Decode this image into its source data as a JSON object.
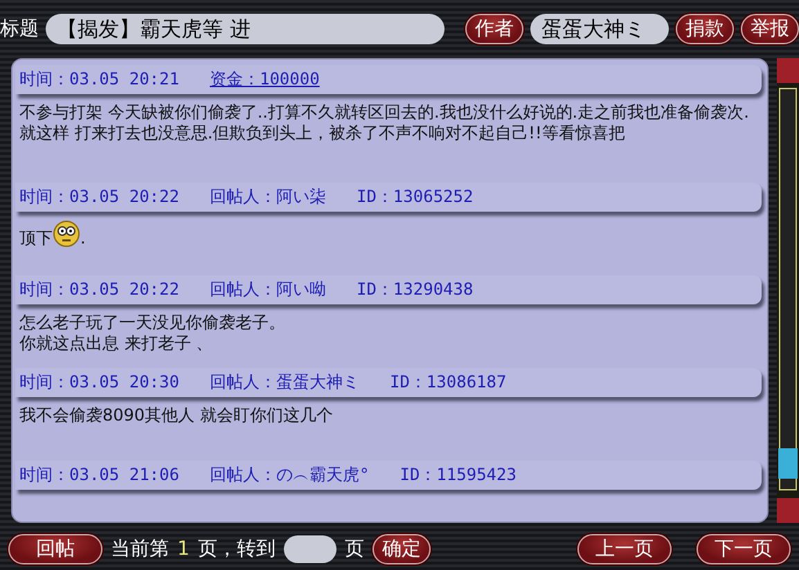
{
  "topbar": {
    "title_label": "标题",
    "title_value": "【揭发】霸天虎等 进",
    "author_button": "作者",
    "author_value": "蛋蛋大神ミ",
    "buttons": [
      "捐款",
      "举报"
    ]
  },
  "posts": [
    {
      "header": [
        {
          "kind": "plain",
          "text": "时间：03.05 20:21"
        },
        {
          "kind": "link",
          "text": "资金：100000"
        }
      ],
      "body": [
        {
          "kind": "text",
          "text": "不参与打架 今天缺被你们偷袭了..打算不久就转区回去的.我也没什么好说的.走之前我也准备偷袭次.就这样 打来打去也没意思.但欺负到头上，被杀了不声不响对不起自己!!等看惊喜把"
        }
      ]
    },
    {
      "header": [
        {
          "kind": "plain",
          "text": "时间：03.05 20:22"
        },
        {
          "kind": "plain",
          "text": "回帖人：阿い柒"
        },
        {
          "kind": "plain",
          "text": "ID：13065252"
        }
      ],
      "body": [
        {
          "kind": "text",
          "text": "顶下"
        },
        {
          "kind": "emoticon"
        },
        {
          "kind": "text",
          "text": "."
        }
      ]
    },
    {
      "header": [
        {
          "kind": "plain",
          "text": "时间：03.05 20:22"
        },
        {
          "kind": "plain",
          "text": "回帖人：阿い呦"
        },
        {
          "kind": "plain",
          "text": "ID：13290438"
        }
      ],
      "body": [
        {
          "kind": "text",
          "text": "怎么老子玩了一天没见你偷袭老子。"
        },
        {
          "kind": "break"
        },
        {
          "kind": "text",
          "text": "你就这点出息 来打老子 、"
        }
      ]
    },
    {
      "header": [
        {
          "kind": "plain",
          "text": "时间：03.05 20:30"
        },
        {
          "kind": "plain",
          "text": "回帖人：蛋蛋大神ミ"
        },
        {
          "kind": "plain",
          "text": "ID：13086187"
        }
      ],
      "body": [
        {
          "kind": "text",
          "text": "我不会偷袭8090其他人 就会盯你们这几个"
        }
      ]
    },
    {
      "header": [
        {
          "kind": "plain",
          "text": "时间：03.05 21:06"
        },
        {
          "kind": "plain",
          "text": "回帖人：の︵霸天虎°"
        },
        {
          "kind": "plain",
          "text": "ID：11595423"
        }
      ]
    }
  ],
  "footer": {
    "reply_button": "回帖",
    "page_prefix": "当前第",
    "page_number": "1",
    "page_middle": "页，转到",
    "page_suffix": "页",
    "go_button": "确定",
    "prev_button": "上一页",
    "next_button": "下一页"
  }
}
